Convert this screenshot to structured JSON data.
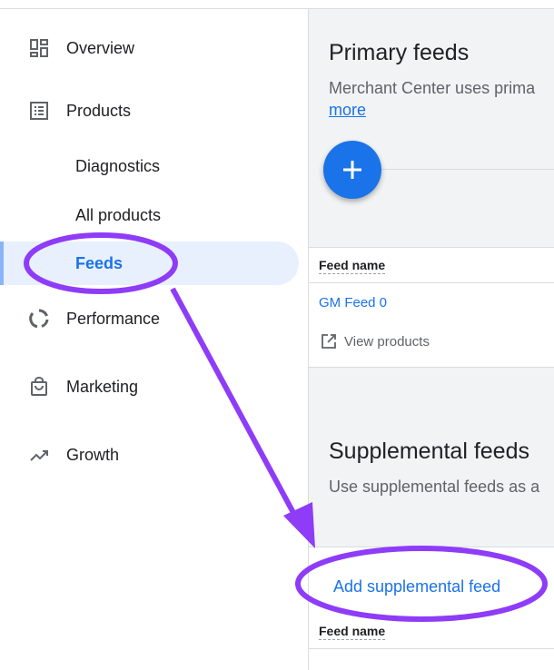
{
  "sidebar": {
    "items": [
      {
        "label": "Overview",
        "icon": "dashboard-icon"
      },
      {
        "label": "Products",
        "icon": "list-icon"
      },
      {
        "label": "Performance",
        "icon": "donut-icon"
      },
      {
        "label": "Marketing",
        "icon": "shopping-bag-icon"
      },
      {
        "label": "Growth",
        "icon": "trending-up-icon"
      }
    ],
    "product_subitems": [
      {
        "label": "Diagnostics"
      },
      {
        "label": "All products"
      },
      {
        "label": "Feeds",
        "active": true
      }
    ]
  },
  "primary": {
    "title": "Primary feeds",
    "description": "Merchant Center uses prima",
    "more_link": "more",
    "table_header": "Feed name",
    "feed_name": "GM Feed 0",
    "view_products": "View products"
  },
  "supplemental": {
    "title": "Supplemental feeds",
    "description": "Use supplemental feeds as a",
    "add_button": "Add supplemental feed",
    "table_header": "Feed name"
  },
  "colors": {
    "accent": "#1a73e8",
    "annotation": "#8e3cf7",
    "active_bg": "#e8f0fe"
  }
}
